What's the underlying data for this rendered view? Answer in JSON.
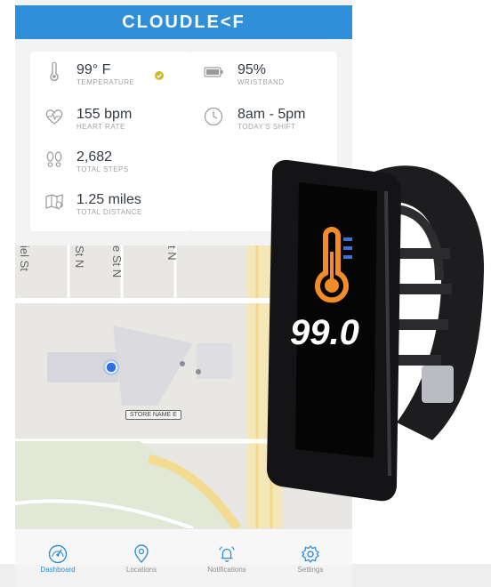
{
  "header": {
    "logo": "CLOUDLE<F"
  },
  "stats_left": [
    {
      "value": "99° F",
      "label": "TEMPERATURE",
      "icon": "thermometer-icon"
    },
    {
      "value": "155 bpm",
      "label": "HEART RATE",
      "icon": "heart-rate-icon"
    },
    {
      "value": "2,682",
      "label": "TOTAL STEPS",
      "icon": "footsteps-icon"
    },
    {
      "value": "1.25 miles",
      "label": "TOTAL DISTANCE",
      "icon": "map-distance-icon"
    }
  ],
  "stats_right": [
    {
      "value": "95%",
      "label": "WRISTBAND",
      "icon": "battery-icon"
    },
    {
      "value": "8am - 5pm",
      "label": "TODAY'S SHIFT",
      "icon": "clock-icon"
    }
  ],
  "map": {
    "streets": [
      "iel St",
      "St N",
      "e St N",
      "t N"
    ],
    "store_label": "STORE NAME E"
  },
  "nav": [
    {
      "label": "Dashboard",
      "icon": "dashboard-gauge-icon",
      "active": true
    },
    {
      "label": "Locations",
      "icon": "location-pin-icon",
      "active": false
    },
    {
      "label": "Notifications",
      "icon": "bell-icon",
      "active": false
    },
    {
      "label": "Settings",
      "icon": "gear-icon",
      "active": false
    }
  ],
  "wristband": {
    "reading": "99.0",
    "icon": "thermometer-icon"
  },
  "colors": {
    "brand": "#2f8fd8",
    "check": "#c9b92e",
    "band_icon": "#f28c28",
    "band_bar": "#3b6fd9"
  }
}
